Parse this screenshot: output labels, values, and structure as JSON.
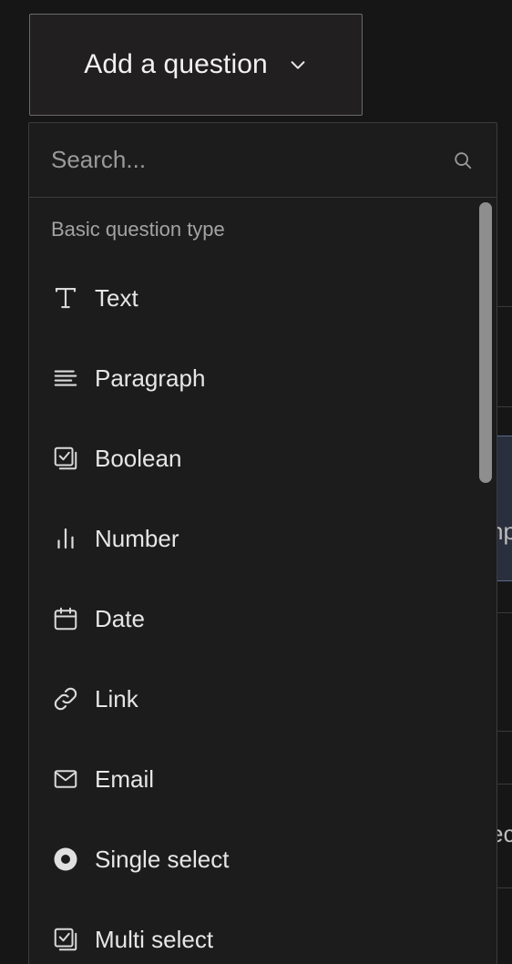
{
  "trigger": {
    "label": "Add a question",
    "icon": "chevron-down-icon"
  },
  "search": {
    "placeholder": "Search...",
    "icon": "search-icon"
  },
  "section": {
    "title": "Basic question type"
  },
  "items": [
    {
      "label": "Text",
      "icon": "text-icon"
    },
    {
      "label": "Paragraph",
      "icon": "paragraph-icon"
    },
    {
      "label": "Boolean",
      "icon": "boolean-checkbox-icon"
    },
    {
      "label": "Number",
      "icon": "number-bars-icon"
    },
    {
      "label": "Date",
      "icon": "calendar-icon"
    },
    {
      "label": "Link",
      "icon": "link-icon"
    },
    {
      "label": "Email",
      "icon": "envelope-icon"
    },
    {
      "label": "Single select",
      "icon": "radio-icon"
    },
    {
      "label": "Multi select",
      "icon": "multi-checkbox-icon"
    }
  ],
  "background": {
    "fragment_1": "np",
    "fragment_2": "ec"
  },
  "colors": {
    "background": "#161616",
    "dropdown": "#1c1c1c",
    "text": "#e6e6e6",
    "muted": "#a3a3a3",
    "border": "#3b3b3b"
  }
}
